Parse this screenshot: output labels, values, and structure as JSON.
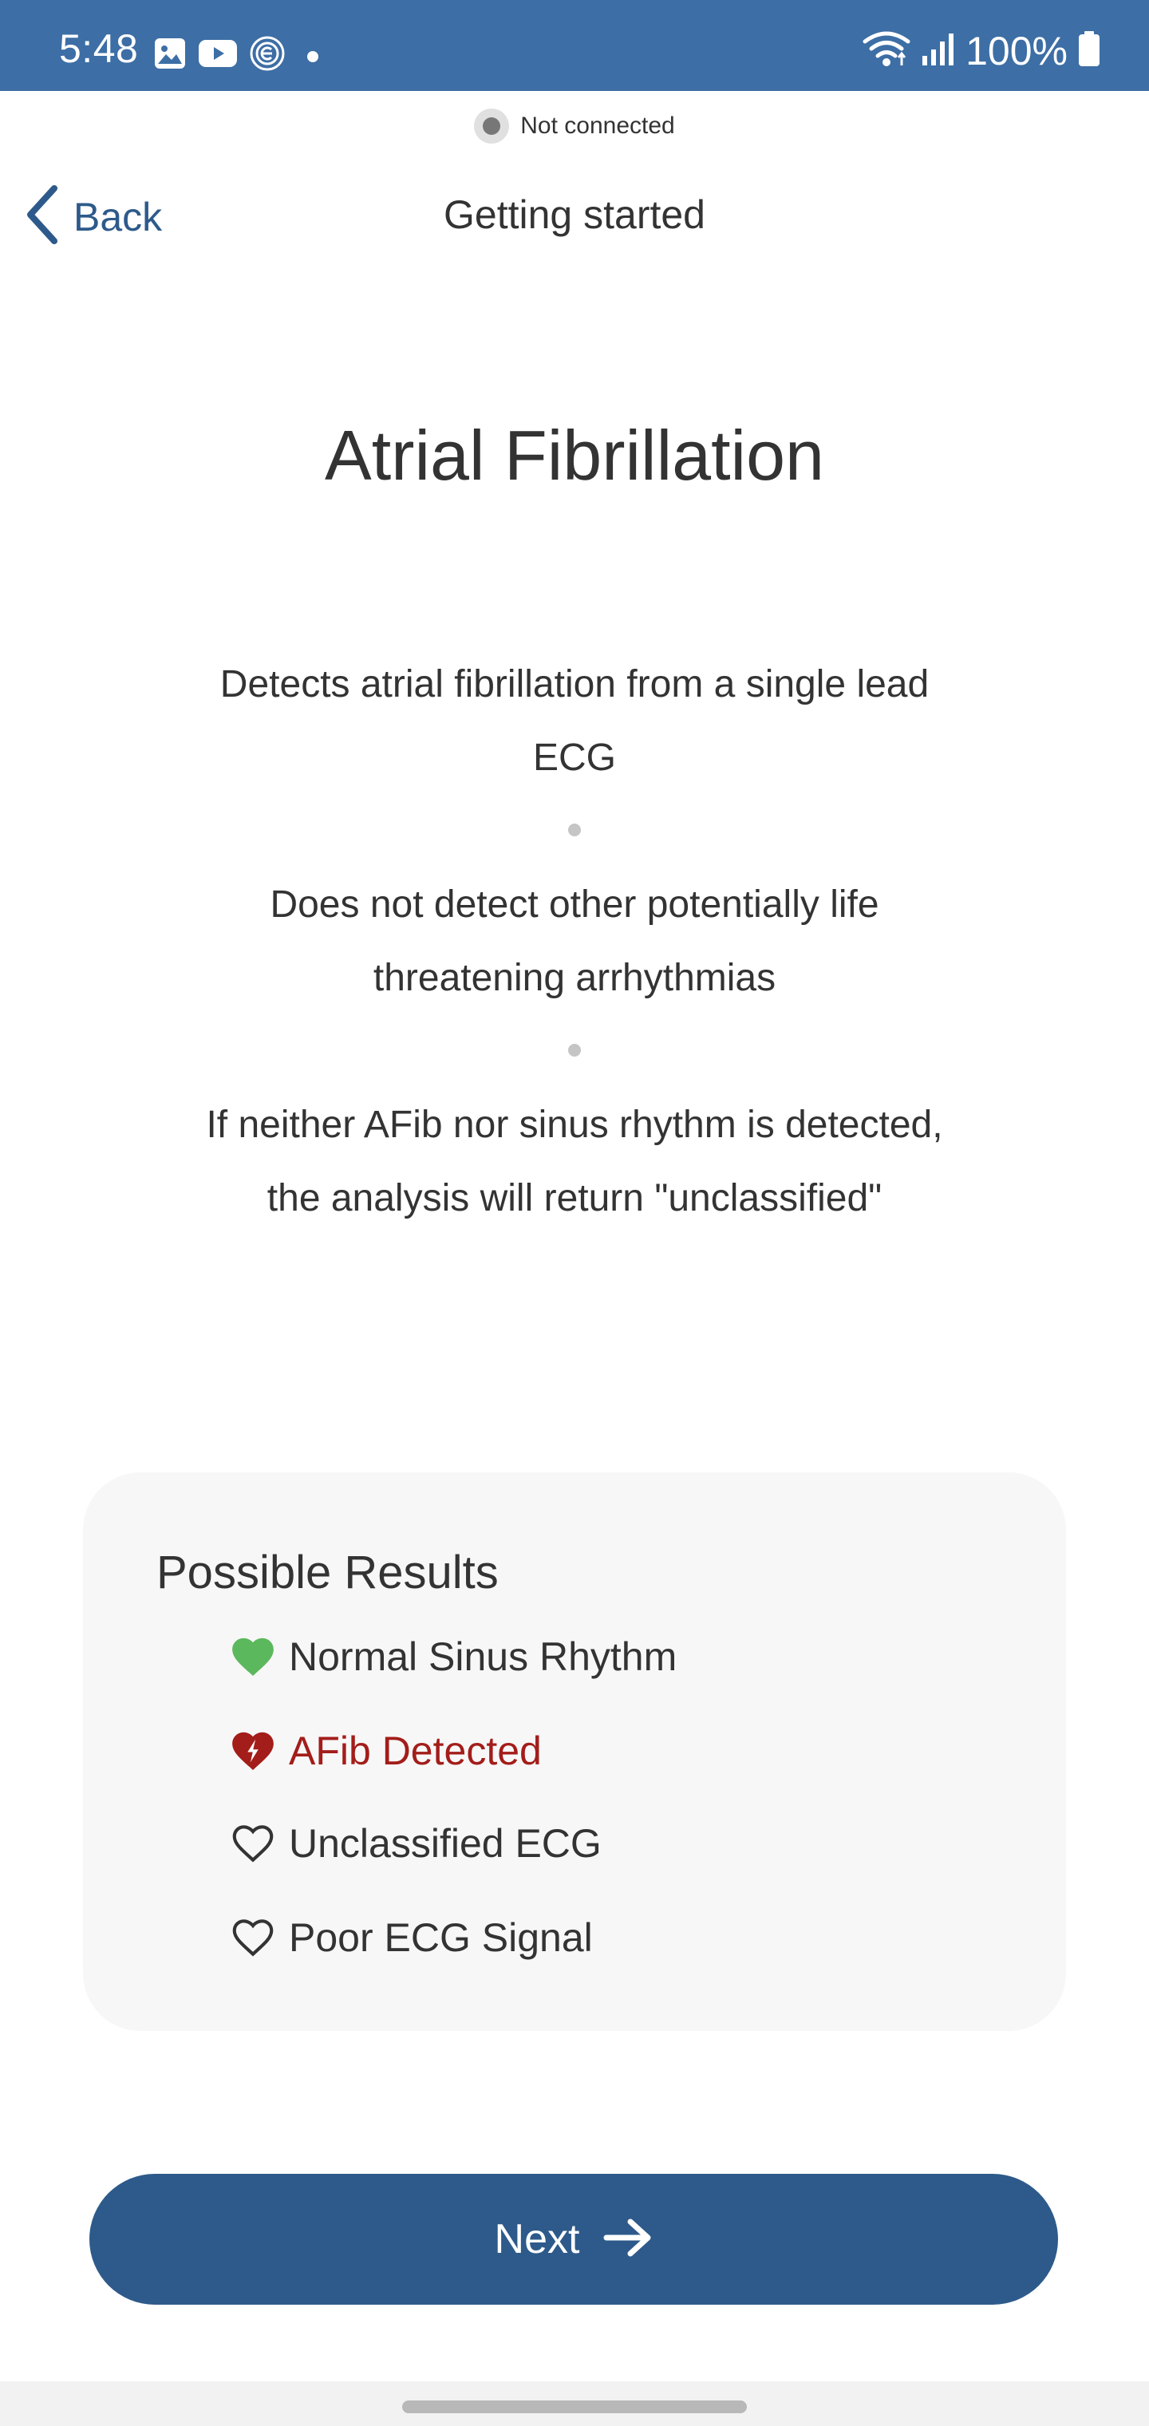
{
  "status_bar": {
    "time": "5:48",
    "battery": "100%",
    "left_icons": [
      "gallery-icon",
      "youtube-icon",
      "app-e-icon",
      "dot-icon"
    ],
    "right_icons": [
      "wifi-icon",
      "signal-icon",
      "battery-icon"
    ],
    "background_color": "#3d6ea5"
  },
  "connection": {
    "status": "Not connected"
  },
  "header": {
    "back_label": "Back",
    "title": "Getting started"
  },
  "main": {
    "title": "Atrial Fibrillation",
    "descriptions": [
      "Detects atrial fibrillation from a single lead ECG",
      "Does not detect other potentially life threatening arrhythmias",
      "If neither AFib nor sinus rhythm is detected, the analysis will return \"unclassified\""
    ]
  },
  "results": {
    "title": "Possible Results",
    "items": [
      {
        "label": "Normal Sinus Rhythm",
        "icon": "green-heart-icon",
        "color": "#333333",
        "icon_color": "#5cb85c"
      },
      {
        "label": "AFib Detected",
        "icon": "afib-heart-icon",
        "color": "#a31d1a",
        "icon_color": "#a31d1a"
      },
      {
        "label": "Unclassified ECG",
        "icon": "heart-outline-icon",
        "color": "#333333",
        "icon_color": "#333333"
      },
      {
        "label": "Poor ECG Signal",
        "icon": "heart-outline-icon",
        "color": "#333333",
        "icon_color": "#333333"
      }
    ]
  },
  "footer": {
    "next_label": "Next",
    "button_color": "#2d5a8a"
  }
}
